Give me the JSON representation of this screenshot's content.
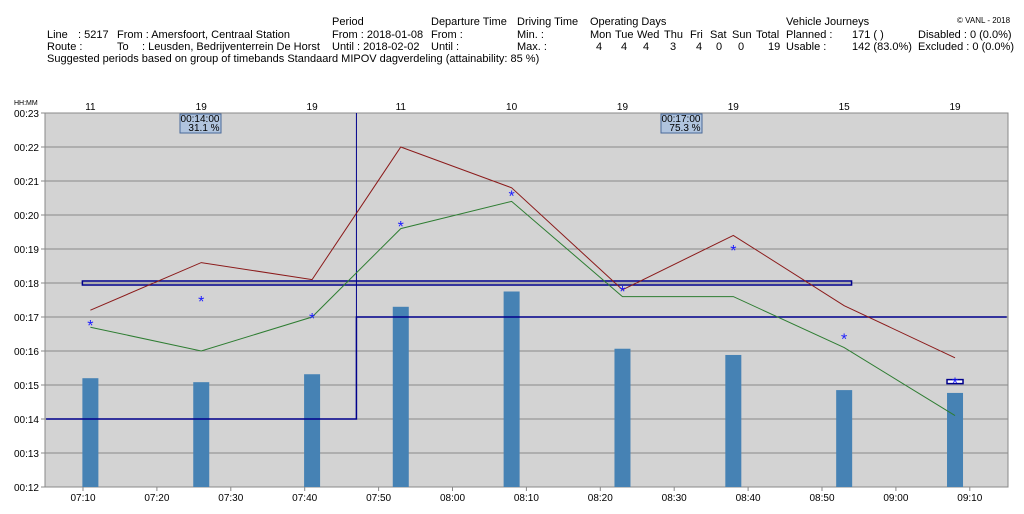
{
  "header": {
    "line_label": "Line",
    "line_value": ": 5217",
    "route_label": "Route :",
    "from_label": "From : Amersfoort, Centraal Station",
    "to_label": "To",
    "to_value": ": Leusden, Bedrijventerrein De Horst",
    "suggestion": "Suggested periods based on group of timebands Standaard MIPOV dagverdeling (attainability: 85 %)",
    "period_title": "Period",
    "period_from": "From : 2018-01-08",
    "period_until": "Until  : 2018-02-02",
    "dep_title": "Departure Time",
    "dep_from": "From :",
    "dep_until": "Until  :",
    "drive_title": "Driving Time",
    "drive_min": "Min.  :",
    "drive_max": "Max.  :",
    "opdays_title": "Operating Days",
    "days": [
      "Mon",
      "Tue",
      "Wed",
      "Thu",
      "Fri",
      "Sat",
      "Sun",
      "Total"
    ],
    "day_counts": [
      "4",
      "4",
      "4",
      "3",
      "4",
      "0",
      "0",
      "19"
    ],
    "vj_title": "Vehicle Journeys",
    "planned": "Planned :",
    "planned_value": "171 (        )",
    "usable": "Usable   :",
    "usable_value": "142 (83.0%)",
    "disabled": "Disabled : 0 (0.0%)",
    "excluded": "Excluded : 0 (0.0%)",
    "copyright": "© VANL - 2018"
  },
  "chart_data": {
    "type": "bar",
    "ylabel": "HH:MM",
    "ylim": [
      "00:12",
      "00:23"
    ],
    "yticks": [
      "00:23",
      "00:22",
      "00:21",
      "00:20",
      "00:19",
      "00:18",
      "00:17",
      "00:16",
      "00:15",
      "00:14",
      "00:13",
      "00:12"
    ],
    "xlim": [
      "07:05",
      "09:15"
    ],
    "xticks": [
      "07:10",
      "07:20",
      "07:30",
      "07:40",
      "07:50",
      "08:00",
      "08:10",
      "08:20",
      "08:30",
      "08:40",
      "08:50",
      "09:00",
      "09:10"
    ],
    "grid": true,
    "colors": {
      "bar": "#4682b4",
      "max": "#8b1a1a",
      "min": "#2e7d32",
      "mean": "#1a1aff",
      "period": "#00008b",
      "plot_bg": "#d3d3d3"
    },
    "groups": [
      {
        "time": "07:11",
        "count": "11",
        "bar": "00:15:12",
        "max": "00:17:12",
        "min": "00:16:42",
        "mean": "00:16:48"
      },
      {
        "time": "07:26",
        "count": "19",
        "bar": "00:15:05",
        "max": "00:18:36",
        "min": "00:16:00",
        "mean": "00:17:30"
      },
      {
        "time": "07:41",
        "count": "19",
        "bar": "00:15:19",
        "max": "00:18:06",
        "min": "00:17:00",
        "mean": "00:17:00"
      },
      {
        "time": "07:53",
        "count": "11",
        "bar": "00:17:18",
        "max": "00:22:00",
        "min": "00:19:36",
        "mean": "00:19:42"
      },
      {
        "time": "08:08",
        "count": "10",
        "bar": "00:17:45",
        "max": "00:20:48",
        "min": "00:20:24",
        "mean": "00:20:36"
      },
      {
        "time": "08:23",
        "count": "19",
        "bar": "00:16:04",
        "max": "00:17:48",
        "min": "00:17:36",
        "mean": "00:17:48"
      },
      {
        "time": "08:38",
        "count": "19",
        "bar": "00:15:53",
        "max": "00:19:24",
        "min": "00:17:36",
        "mean": "00:19:00"
      },
      {
        "time": "08:53",
        "count": "15",
        "bar": "00:14:51",
        "max": "00:17:20",
        "min": "00:16:06",
        "mean": "00:16:24"
      },
      {
        "time": "09:08",
        "count": "19",
        "bar": "00:14:46",
        "max": "00:15:48",
        "min": "00:14:06",
        "mean": "00:15:06"
      }
    ],
    "periods": [
      {
        "start": "07:05",
        "end": "07:47",
        "value": "00:14:00",
        "label_time": "00:14:00",
        "label_pct": "31.1 %"
      },
      {
        "start": "07:47",
        "end": "09:15",
        "value": "00:17:00",
        "label_time": "00:17:00",
        "label_pct": "75.3 %"
      }
    ],
    "target_line": {
      "start": "07:11",
      "end": "08:54",
      "value": "00:18:00"
    },
    "target_box_last": "00:15:06"
  }
}
